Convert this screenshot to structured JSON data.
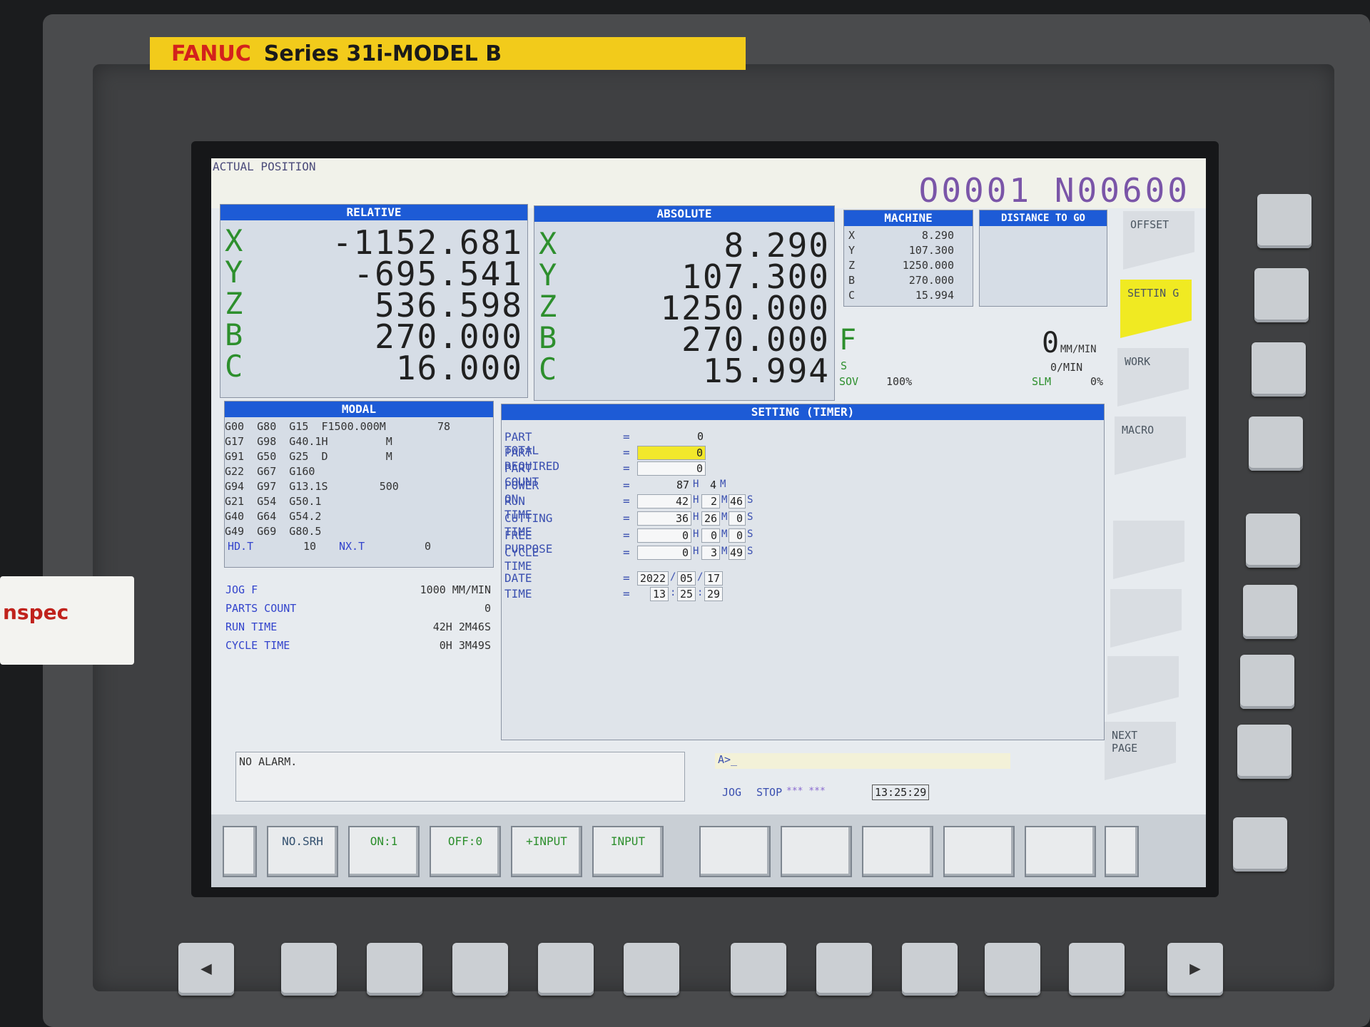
{
  "brand": {
    "maker": "FANUC",
    "model": "Series 31i-MODEL B"
  },
  "screen_title": "ACTUAL POSITION",
  "program": "O0001 N00600",
  "relative": {
    "header": "RELATIVE",
    "axes": [
      {
        "label": "X",
        "value": "-1152.681"
      },
      {
        "label": "Y",
        "value": "-695.541"
      },
      {
        "label": "Z",
        "value": "536.598"
      },
      {
        "label": "B",
        "value": "270.000"
      },
      {
        "label": "C",
        "value": "16.000"
      }
    ]
  },
  "absolute": {
    "header": "ABSOLUTE",
    "axes": [
      {
        "label": "X",
        "value": "8.290"
      },
      {
        "label": "Y",
        "value": "107.300"
      },
      {
        "label": "Z",
        "value": "1250.000"
      },
      {
        "label": "B",
        "value": "270.000"
      },
      {
        "label": "C",
        "value": "15.994"
      }
    ]
  },
  "machine": {
    "header": "MACHINE",
    "axes": [
      {
        "label": "X",
        "value": "8.290"
      },
      {
        "label": "Y",
        "value": "107.300"
      },
      {
        "label": "Z",
        "value": "1250.000"
      },
      {
        "label": "B",
        "value": "270.000"
      },
      {
        "label": "C",
        "value": "15.994"
      }
    ]
  },
  "distance_to_go": {
    "header": "DISTANCE TO GO"
  },
  "feed": {
    "f_label": "F",
    "f_value": "0",
    "f_unit": "MM/MIN",
    "s_label": "S",
    "s_value": "0/MIN",
    "sov_label": "SOV",
    "sov_value": "100%",
    "slm_label": "SLM",
    "slm_value": "0%"
  },
  "modal": {
    "header": "MODAL",
    "lines": [
      "G00  G80  G15  F1500.000M        78",
      "G17  G98  G40.1H         M",
      "G91  G50  G25  D         M",
      "G22  G67  G160",
      "G94  G97  G13.1S        500",
      "G21  G54  G50.1",
      "G40  G64  G54.2",
      "G49  G69  G80.5"
    ],
    "hd_t_label": "HD.T",
    "hd_t_value": "10",
    "nx_t_label": "NX.T",
    "nx_t_value": "0"
  },
  "status_left": [
    {
      "label": "JOG F",
      "value": "1000 MM/MIN"
    },
    {
      "label": "PARTS COUNT",
      "value": "0"
    },
    {
      "label": "RUN TIME",
      "value": "42H 2M46S"
    },
    {
      "label": "CYCLE TIME",
      "value": "0H 3M49S"
    }
  ],
  "setting": {
    "header": "SETTING (TIMER)",
    "part_total": {
      "label": "PART TOTAL",
      "value": "0"
    },
    "part_required": {
      "label": "PART REQUIRED",
      "value": "0"
    },
    "part_count": {
      "label": "PART COUNT",
      "value": "0"
    },
    "power_on": {
      "label": "POWER ON",
      "h": "87",
      "m": "4"
    },
    "run_time": {
      "label": "RUN TIME",
      "h": "42",
      "m": "2",
      "s": "46"
    },
    "cutting_time": {
      "label": "CUTTING TIME",
      "h": "36",
      "m": "26",
      "s": "0"
    },
    "free_purpose": {
      "label": "FREE PURPOSE",
      "h": "0",
      "m": "0",
      "s": "0"
    },
    "cycle_time": {
      "label": "CYCLE TIME",
      "h": "0",
      "m": "3",
      "s": "49"
    },
    "date": {
      "label": "DATE",
      "y": "2022",
      "mo": "05",
      "d": "17"
    },
    "time": {
      "label": "TIME",
      "h": "13",
      "m": "25",
      "s": "29"
    },
    "eq": "=",
    "unit_h": "H",
    "unit_m": "M",
    "unit_s": "S"
  },
  "alarm": {
    "text": "NO ALARM."
  },
  "input_line": {
    "prompt": "A>_"
  },
  "state": {
    "mode": "JOG",
    "status": "STOP",
    "stars": "*** ***",
    "clock": "13:25:29"
  },
  "softkeys": [
    "",
    "NO.SRH",
    "ON:1",
    "OFF:0",
    "+INPUT",
    "INPUT",
    "",
    "",
    "",
    "",
    "",
    ""
  ],
  "vertical_keys": [
    "OFFSET",
    "SETTIN G",
    "WORK",
    "MACRO",
    "",
    "",
    "",
    "NEXT PAGE"
  ],
  "arrows": {
    "left": "◀",
    "right": "▶"
  },
  "sticker": {
    "text": "nspec"
  }
}
